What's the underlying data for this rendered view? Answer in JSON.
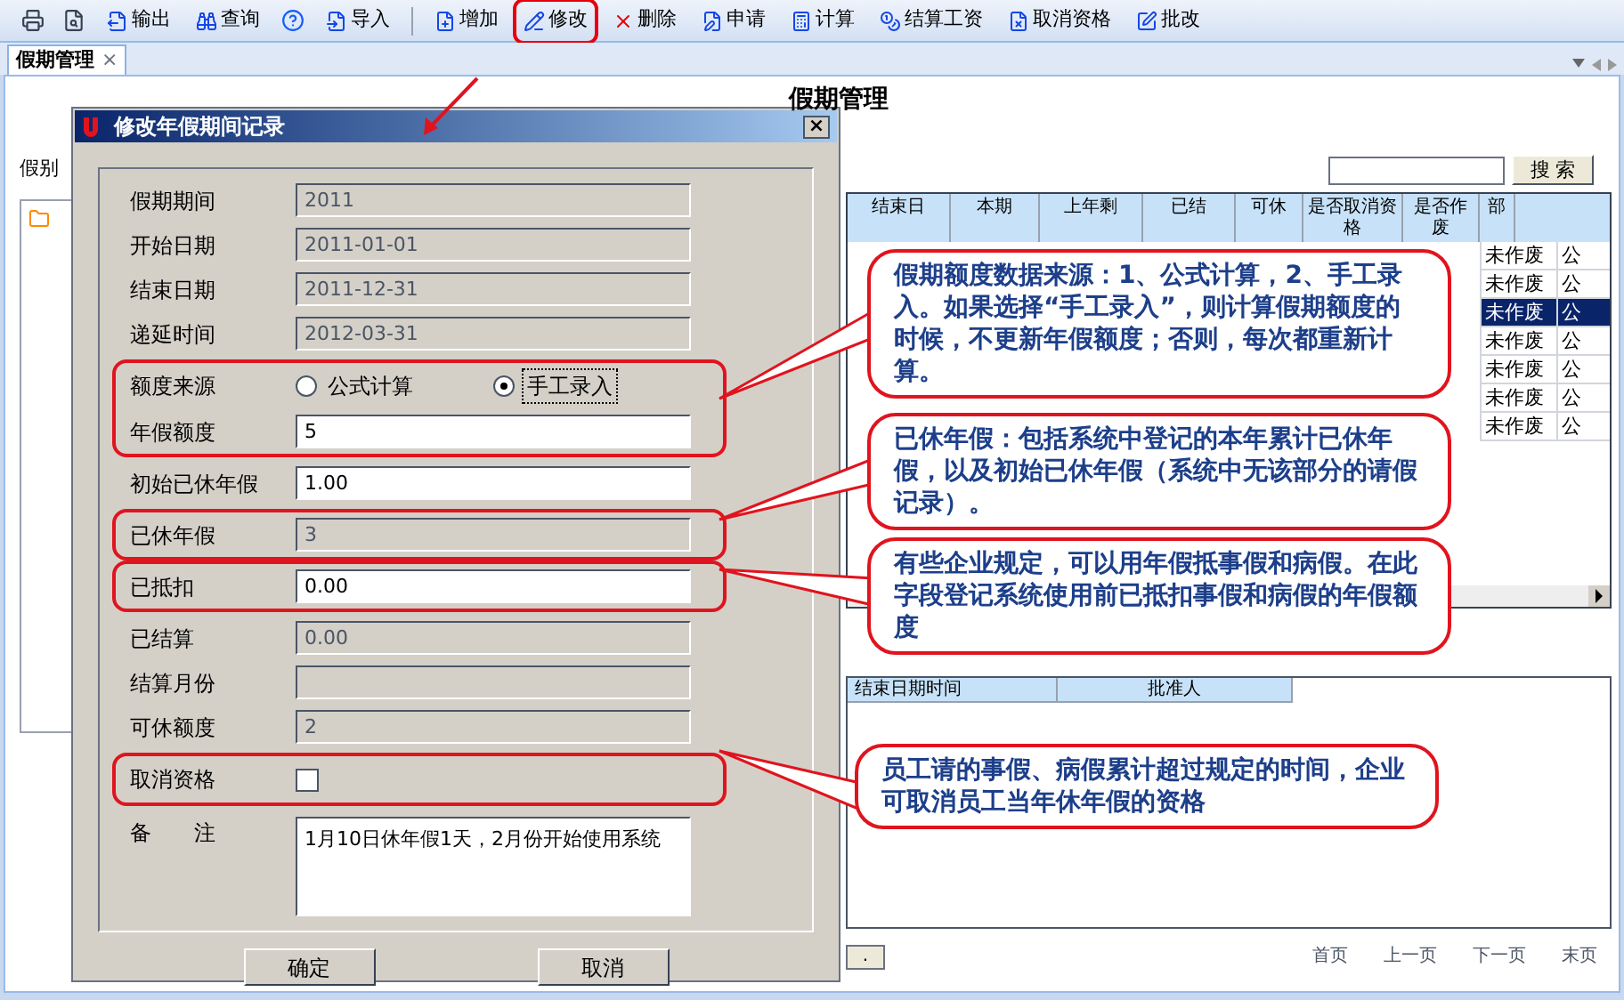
{
  "toolbar": [
    {
      "kind": "icon"
    },
    {
      "kind": "icon"
    },
    {
      "kind": "button",
      "label": "输出",
      "highlighted": false
    },
    {
      "kind": "button",
      "label": "查询",
      "highlighted": false
    },
    {
      "kind": "icon"
    },
    {
      "kind": "button",
      "label": "导入",
      "highlighted": false
    },
    {
      "kind": "separator"
    },
    {
      "kind": "button",
      "label": "增加",
      "highlighted": false
    },
    {
      "kind": "button",
      "label": "修改",
      "highlighted": true
    },
    {
      "kind": "button",
      "label": "删除",
      "highlighted": false
    },
    {
      "kind": "button",
      "label": "申请",
      "highlighted": false
    },
    {
      "kind": "button",
      "label": "计算",
      "highlighted": false
    },
    {
      "kind": "button",
      "label": "结算工资",
      "highlighted": false
    },
    {
      "kind": "button",
      "label": "取消资格",
      "highlighted": false
    },
    {
      "kind": "button",
      "label": "批改",
      "highlighted": false
    }
  ],
  "tabs": [
    {
      "label": "假期管理",
      "selected": true,
      "close": "×"
    }
  ],
  "page_title": "假期管理",
  "sidebar": {
    "label": "假别"
  },
  "search": {
    "button": "搜 索"
  },
  "table": {
    "columns": [
      "结束日",
      "本期",
      "上年剩",
      "已结",
      "可休",
      "是否取消资格",
      "是否作废",
      "部"
    ],
    "rows": [
      {
        "void": "未作废",
        "column_8": "公",
        "selected": false
      },
      {
        "void": "未作废",
        "column_8": "公",
        "selected": false
      },
      {
        "void": "未作废",
        "column_8": "公",
        "selected": true
      },
      {
        "void": "未作废",
        "column_8": "公",
        "selected": false
      },
      {
        "void": "未作废",
        "column_8": "公",
        "selected": false
      },
      {
        "void": "未作废",
        "column_8": "公",
        "selected": false
      },
      {
        "void": "未作废",
        "column_8": "公",
        "selected": false
      }
    ]
  },
  "detail_table": {
    "columns": [
      "结束日期时间",
      "批准人"
    ]
  },
  "pager": {
    "goto_button": ".",
    "links": [
      "首页",
      "上一页",
      "下一页",
      "末页"
    ]
  },
  "dialog": {
    "title": "修改年假期间记录",
    "close": "×",
    "groups": [
      {
        "highlighted": false,
        "fields": [
          {
            "kind": "text",
            "label": "假期期间",
            "value": "2011",
            "disabled": true
          },
          {
            "kind": "text",
            "label": "开始日期",
            "value": "2011-01-01",
            "disabled": true
          },
          {
            "kind": "text",
            "label": "结束日期",
            "value": "2011-12-31",
            "disabled": true
          },
          {
            "kind": "text",
            "label": "递延时间",
            "value": "2012-03-31",
            "disabled": true
          }
        ]
      },
      {
        "highlighted": true,
        "fields": [
          {
            "kind": "radio",
            "label": "额度来源",
            "options": [
              {
                "label": "公式计算",
                "selected": false
              },
              {
                "label": "手工录入",
                "selected": true
              }
            ]
          },
          {
            "kind": "text",
            "label": "年假额度",
            "value": "5",
            "disabled": false
          }
        ]
      },
      {
        "highlighted": false,
        "fields": [
          {
            "kind": "text",
            "label": "初始已休年假",
            "value": "1.00",
            "disabled": false
          }
        ]
      },
      {
        "highlighted": true,
        "fields": [
          {
            "kind": "text",
            "label": "已休年假",
            "value": "3",
            "disabled": true
          }
        ]
      },
      {
        "highlighted": true,
        "fields": [
          {
            "kind": "text",
            "label": "已抵扣",
            "value": "0.00",
            "disabled": false
          }
        ]
      },
      {
        "highlighted": false,
        "fields": [
          {
            "kind": "text",
            "label": "已结算",
            "value": "0.00",
            "disabled": true
          },
          {
            "kind": "text",
            "label": "结算月份",
            "disabled": true
          },
          {
            "kind": "text",
            "label": "可休额度",
            "value": "2",
            "disabled": true
          }
        ]
      },
      {
        "highlighted": true,
        "fields": [
          {
            "kind": "checkbox",
            "label": "取消资格",
            "checked": false
          }
        ]
      },
      {
        "highlighted": false,
        "fields": [
          {
            "kind": "textarea",
            "label": "备　　注",
            "value": "1月10日休年假1天，2月份开始使用系统"
          }
        ]
      }
    ],
    "buttons": [
      "确定",
      "取消"
    ]
  },
  "callouts": [
    "假期额度数据来源：1、公式计算，2、手工录入。如果选择“手工录入”，则计算假期额度的时候，不更新年假额度；否则，每次都重新计算。",
    "已休年假：包括系统中登记的本年累计已休年假，以及初始已休年假（系统中无该部分的请假记录）。",
    "有些企业规定，可以用年假抵事假和病假。在此字段登记系统使用前已抵扣事假和病假的年假额度",
    "员工请的事假、病假累计超过规定的时间，企业可取消员工当年休年假的资格"
  ]
}
